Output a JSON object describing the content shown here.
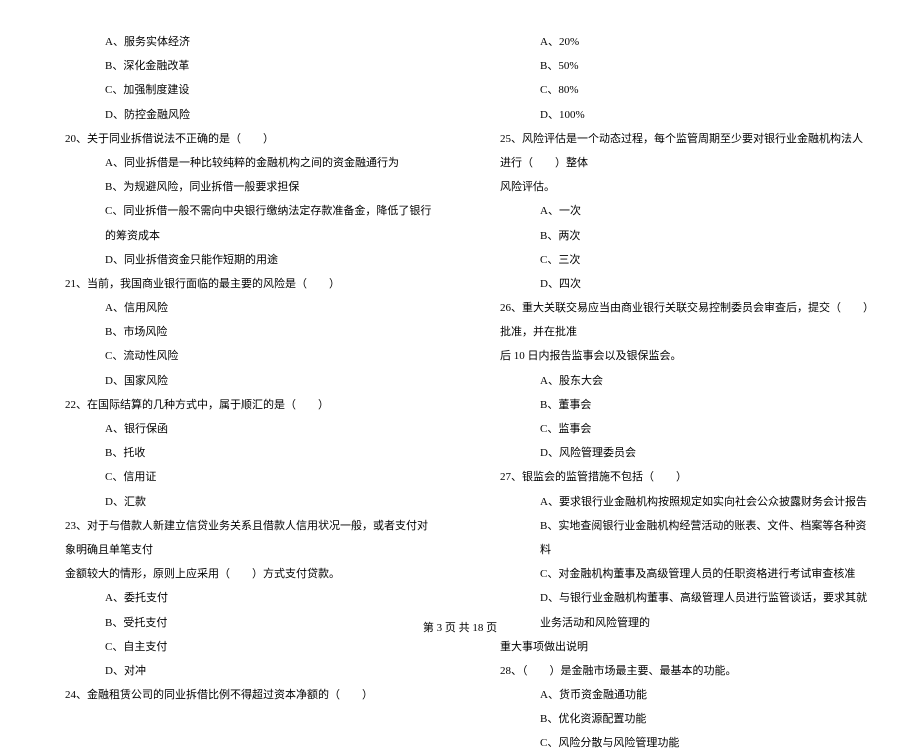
{
  "left": {
    "q19_options": {
      "a": "A、服务实体经济",
      "b": "B、深化金融改革",
      "c": "C、加强制度建设",
      "d": "D、防控金融风险"
    },
    "q20": {
      "stem": "20、关于同业拆借说法不正确的是（　　）",
      "a": "A、同业拆借是一种比较纯粹的金融机构之间的资金融通行为",
      "b": "B、为规避风险，同业拆借一般要求担保",
      "c": "C、同业拆借一般不需向中央银行缴纳法定存款准备金，降低了银行的筹资成本",
      "d": "D、同业拆借资金只能作短期的用途"
    },
    "q21": {
      "stem": "21、当前，我国商业银行面临的最主要的风险是（　　）",
      "a": "A、信用风险",
      "b": "B、市场风险",
      "c": "C、流动性风险",
      "d": "D、国家风险"
    },
    "q22": {
      "stem": "22、在国际结算的几种方式中，属于顺汇的是（　　）",
      "a": "A、银行保函",
      "b": "B、托收",
      "c": "C、信用证",
      "d": "D、汇款"
    },
    "q23": {
      "stem": "23、对于与借款人新建立信贷业务关系且借款人信用状况一般，或者支付对象明确且单笔支付",
      "stem2": "金额较大的情形，原则上应采用（　　）方式支付贷款。",
      "a": "A、委托支付",
      "b": "B、受托支付",
      "c": "C、自主支付",
      "d": "D、对冲"
    },
    "q24": {
      "stem": "24、金融租赁公司的同业拆借比例不得超过资本净额的（　　）"
    }
  },
  "right": {
    "q24_options": {
      "a": "A、20%",
      "b": "B、50%",
      "c": "C、80%",
      "d": "D、100%"
    },
    "q25": {
      "stem": "25、风险评估是一个动态过程，每个监管周期至少要对银行业金融机构法人进行（　　）整体",
      "stem2": "风险评估。",
      "a": "A、一次",
      "b": "B、两次",
      "c": "C、三次",
      "d": "D、四次"
    },
    "q26": {
      "stem": "26、重大关联交易应当由商业银行关联交易控制委员会审查后，提交（　　）批准，并在批准",
      "stem2": "后 10 日内报告监事会以及银保监会。",
      "a": "A、股东大会",
      "b": "B、董事会",
      "c": "C、监事会",
      "d": "D、风险管理委员会"
    },
    "q27": {
      "stem": "27、银监会的监管措施不包括（　　）",
      "a": "A、要求银行业金融机构按照规定如实向社会公众披露财务会计报告",
      "b": "B、实地查阅银行业金融机构经营活动的账表、文件、档案等各种资料",
      "c": "C、对金融机构董事及高级管理人员的任职资格进行考试审查核准",
      "d": "D、与银行业金融机构董事、高级管理人员进行监管谈话，要求其就业务活动和风险管理的",
      "d2": "重大事项做出说明"
    },
    "q28": {
      "stem": "28、（　　）是金融市场最主要、最基本的功能。",
      "a": "A、货币资金融通功能",
      "b": "B、优化资源配置功能",
      "c": "C、风险分散与风险管理功能"
    }
  },
  "footer": "第 3 页 共 18 页"
}
